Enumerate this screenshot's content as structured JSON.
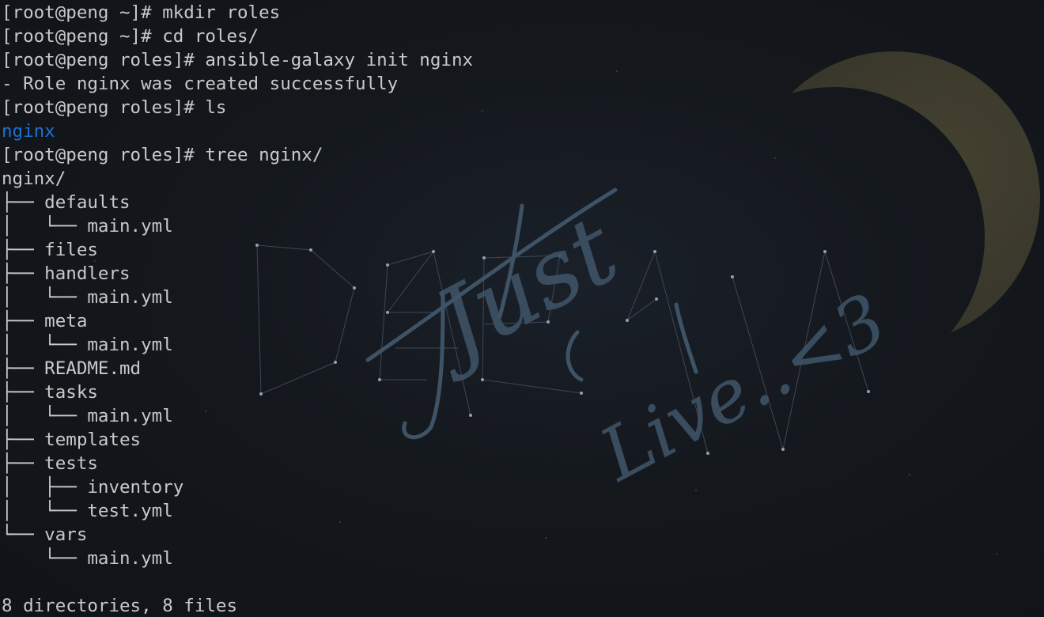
{
  "wallpaper": {
    "text_just": "Just",
    "text_live": "Live..<3"
  },
  "terminal": {
    "lines": [
      {
        "text": "[root@peng ~]# mkdir roles",
        "style": "normal"
      },
      {
        "text": "[root@peng ~]# cd roles/",
        "style": "normal"
      },
      {
        "text": "[root@peng roles]# ansible-galaxy init nginx",
        "style": "normal"
      },
      {
        "text": "- Role nginx was created successfully",
        "style": "normal"
      },
      {
        "text": "[root@peng roles]# ls",
        "style": "normal"
      },
      {
        "text": "nginx",
        "style": "ls-dir"
      },
      {
        "text": "[root@peng roles]# tree nginx/",
        "style": "normal"
      },
      {
        "text": "nginx/",
        "style": "normal"
      },
      {
        "text": "├── defaults",
        "style": "normal"
      },
      {
        "text": "│   └── main.yml",
        "style": "normal"
      },
      {
        "text": "├── files",
        "style": "normal"
      },
      {
        "text": "├── handlers",
        "style": "normal"
      },
      {
        "text": "│   └── main.yml",
        "style": "normal"
      },
      {
        "text": "├── meta",
        "style": "normal"
      },
      {
        "text": "│   └── main.yml",
        "style": "normal"
      },
      {
        "text": "├── README.md",
        "style": "normal"
      },
      {
        "text": "├── tasks",
        "style": "normal"
      },
      {
        "text": "│   └── main.yml",
        "style": "normal"
      },
      {
        "text": "├── templates",
        "style": "normal"
      },
      {
        "text": "├── tests",
        "style": "normal"
      },
      {
        "text": "│   ├── inventory",
        "style": "normal"
      },
      {
        "text": "│   └── test.yml",
        "style": "normal"
      },
      {
        "text": "└── vars",
        "style": "normal"
      },
      {
        "text": "    └── main.yml",
        "style": "normal"
      },
      {
        "text": "",
        "style": "normal"
      },
      {
        "text": "8 directories, 8 files",
        "style": "normal"
      }
    ]
  },
  "colors": {
    "text": "#c9c9c9",
    "ls_directory": "#1f6fd1",
    "background": "#121519",
    "moon": "#3b3a2c"
  }
}
